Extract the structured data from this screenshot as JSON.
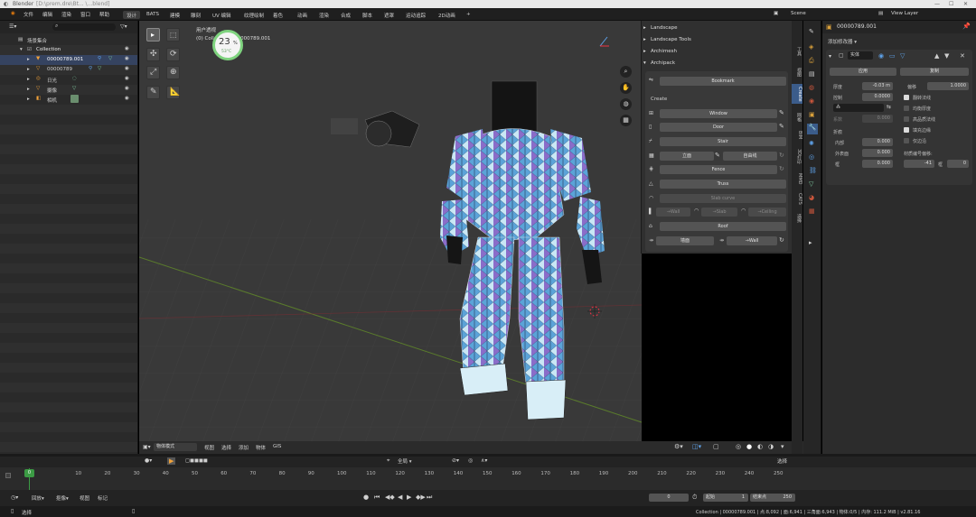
{
  "titlebar": {
    "app": "Blender",
    "path": "[D:\\prem.dre\\Bt... \\...blend]",
    "scene": "Scene",
    "view_layer": "View Layer"
  },
  "menu": [
    "文件",
    "编辑",
    "渲染",
    "窗口",
    "帮助"
  ],
  "workspaces": [
    "设计",
    "BATS",
    "建模",
    "雕刻",
    "UV 编辑",
    "纹理绘制",
    "着色",
    "动画",
    "渲染",
    "合成",
    "脚本",
    "遮罩",
    "运动追踪",
    "2D动画"
  ],
  "outliner": {
    "root": "场景集合",
    "items": [
      "Collection",
      "00000789.001",
      "00000789",
      "日光",
      "摄像",
      "相机"
    ]
  },
  "viewport": {
    "info_line1": "用户透视",
    "info_line2": "(0) Collection | 00000789.001",
    "performance_percent": "23",
    "performance_unit": "%",
    "performance_temp": "53°C",
    "header_items": [
      "物体模式",
      "视图",
      "选择",
      "添加",
      "物体",
      "GIS"
    ]
  },
  "npanel": {
    "sections": [
      "Landscape",
      "Landscape Tools",
      "Archimesh",
      "Archipack"
    ],
    "bookmark": "Bookmark",
    "create_label": "Create",
    "buttons": {
      "window": "Window",
      "door": "Door",
      "stair": "Stair",
      "stand": "立面",
      "custom": "自由线",
      "fence": "Fence",
      "truss": "Truss",
      "slab_curve": "Slab curve",
      "wall": "Wall",
      "slab": "Slab",
      "ceiling": "Ceiling",
      "roof": "Roof",
      "surface": "墙面",
      "to_wall": "Wall"
    }
  },
  "vtabs": [
    "工具",
    "视图",
    "Create",
    "网格",
    "BIM",
    "3D打印",
    "MMD",
    "CATS",
    "选择"
  ],
  "properties": {
    "object_name": "00000789.001",
    "section": "添加修改器",
    "modifier_name": "实体",
    "apply": "应用",
    "copy": "复制",
    "thickness_label": "厚度",
    "thickness_value": "-0.03 m",
    "offset_label": "偏移",
    "offset_value": "1.0000",
    "even_label": "控制",
    "even_value": "0.0000",
    "flip_label": "翻转法线",
    "even_thick_label": "均衡厚度",
    "hq_label": "高品质法线",
    "fill_label": "填充边缘",
    "rim_label": "仅边沿",
    "vgroup_factor_label": "系数",
    "vgroup_factor_value": "0.000",
    "crease_label": "折痕",
    "inner_label": "内部",
    "inner_value": "0.000",
    "outer_label": "外表面",
    "outer_value": "0.000",
    "rim_crease_label": "框",
    "rim_crease_value": "0.000",
    "material_label": "材质编号偏移:",
    "material_value1": "-41",
    "material_value2_label": "框",
    "material_value2": "0"
  },
  "timeline": {
    "current_frame": "0",
    "ticks": [
      "10",
      "20",
      "30",
      "40",
      "50",
      "60",
      "70",
      "80",
      "90",
      "100",
      "110",
      "120",
      "130",
      "140",
      "150",
      "160",
      "170",
      "180",
      "190",
      "200",
      "210",
      "220",
      "230",
      "240",
      "250"
    ],
    "playback": "回放",
    "keying": "抠像",
    "view": "视图",
    "marker": "标记",
    "frame_field": "0",
    "start_label": "起始",
    "start_value": "1",
    "end_label": "结束点",
    "end_value": "250",
    "global": "全局"
  },
  "statusbar": {
    "select": "选择",
    "info": "Collection | 00000789.001 | 点:8,092 | 面:6,941 | 三角面:6,943 | 物体:0/5 | 内存: 111.2 MiB | v2.81.16"
  },
  "colors": {
    "accent": "#4772b3",
    "active_tab": "#3b5c8a",
    "grid_x": "#7d2c33",
    "grid_y": "#5a7b2c",
    "playhead": "#3b9b44"
  }
}
